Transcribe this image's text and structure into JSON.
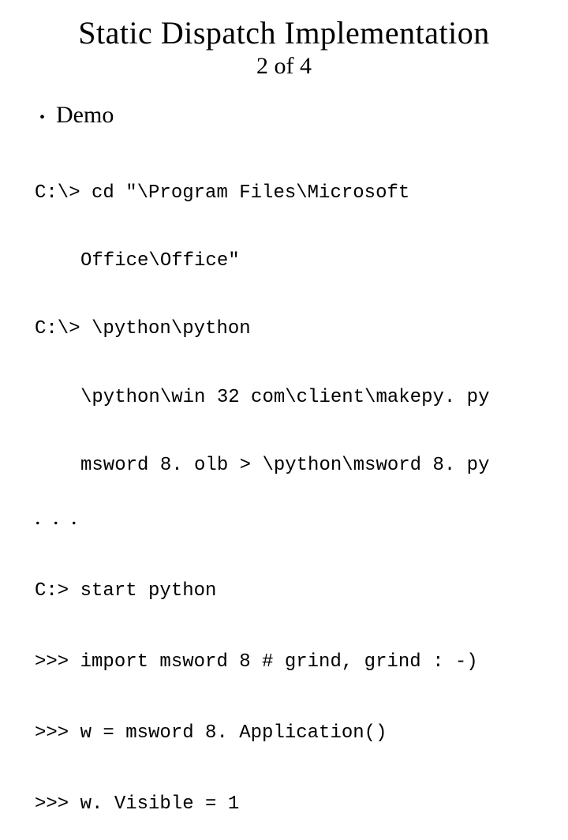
{
  "title": "Static Dispatch Implementation",
  "subtitle": "2 of 4",
  "bullet": "Demo",
  "code": {
    "l1": "C:\\> cd \"\\Program Files\\Microsoft",
    "l2": "Office\\Office\"",
    "l3": "C:\\> \\python\\python",
    "l4": "\\python\\win 32 com\\client\\makepy. py",
    "l5": "msword 8. olb > \\python\\msword 8. py"
  },
  "ellipsis": ". . .",
  "code2": {
    "l1": "C:> start python",
    "l2": ">>> import msword 8 # grind, grind : -)",
    "l3": ">>> w = msword 8. Application()",
    "l4": ">>> w. Visible = 1"
  }
}
